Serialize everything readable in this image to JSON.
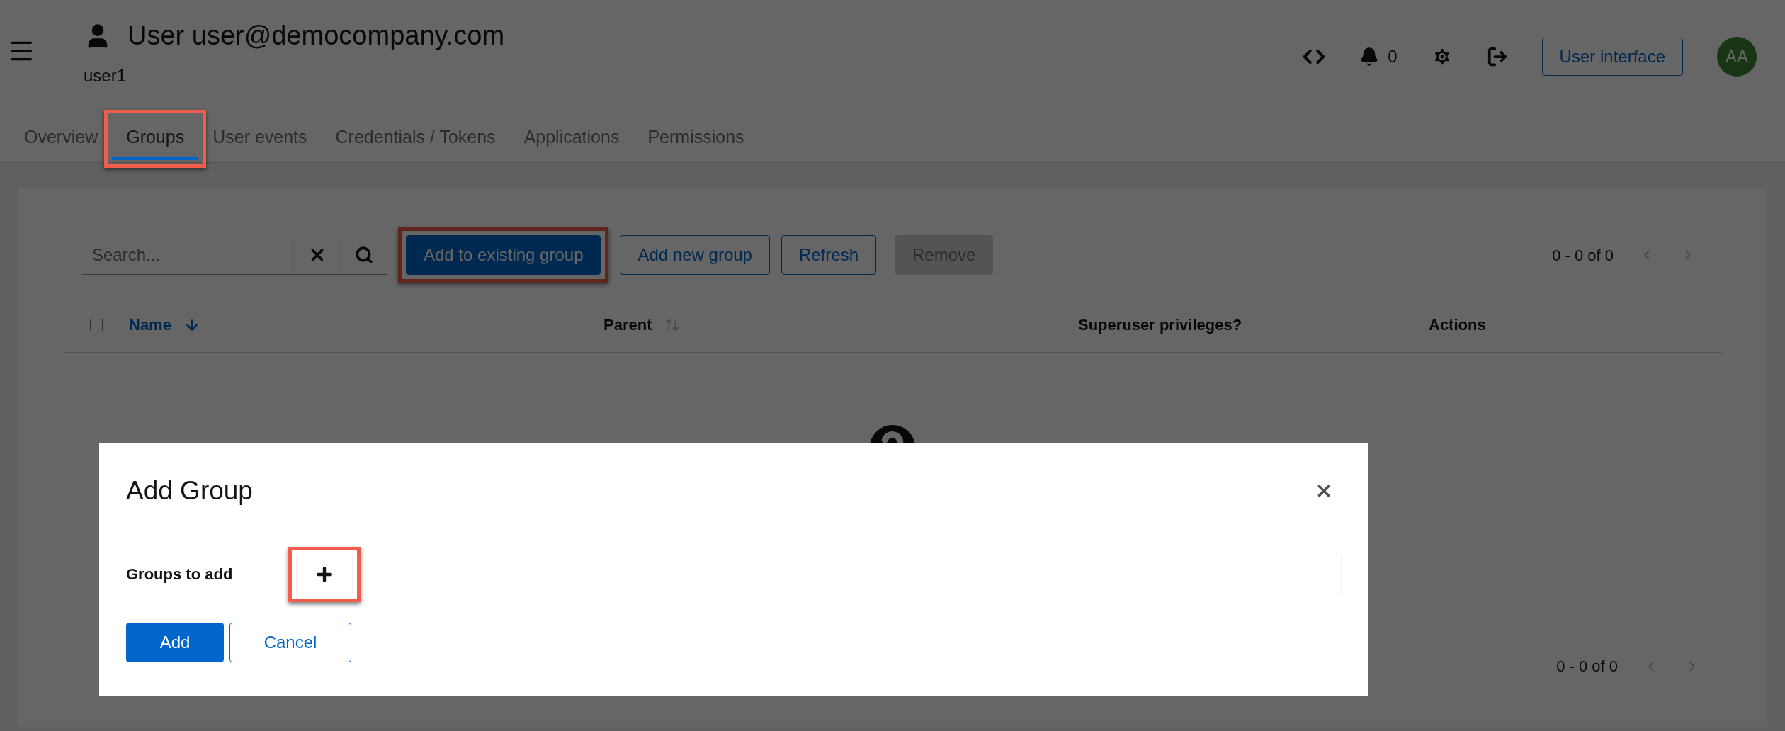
{
  "header": {
    "title": "User user@democompany.com",
    "subtitle": "user1",
    "notifications": "0",
    "ui_button": "User interface",
    "avatar": "AA"
  },
  "tabs": [
    {
      "label": "Overview",
      "selected": false,
      "highlighted": false
    },
    {
      "label": "Groups",
      "selected": true,
      "highlighted": true
    },
    {
      "label": "User events",
      "selected": false,
      "highlighted": false
    },
    {
      "label": "Credentials / Tokens",
      "selected": false,
      "highlighted": false
    },
    {
      "label": "Applications",
      "selected": false,
      "highlighted": false
    },
    {
      "label": "Permissions",
      "selected": false,
      "highlighted": false
    }
  ],
  "toolbar": {
    "search": {
      "placeholder": "Search..."
    },
    "buttons": [
      {
        "label": "Add to existing group",
        "kind": "primary",
        "highlighted": true
      },
      {
        "label": "Add new group",
        "kind": "secondary",
        "highlighted": false
      },
      {
        "label": "Refresh",
        "kind": "secondary",
        "highlighted": false
      },
      {
        "label": "Remove",
        "kind": "disabled",
        "highlighted": false
      }
    ],
    "pagination": "0 - 0 of 0"
  },
  "table": {
    "select_all": {
      "checked": false
    },
    "columns": [
      {
        "label": "Name",
        "sort_active": true
      },
      {
        "label": "Parent",
        "sort_active": false
      },
      {
        "label": "Superuser privileges?"
      },
      {
        "label": "Actions"
      }
    ]
  },
  "footer_pagination": "0 - 0 of 0",
  "dialog": {
    "title": "Add Group",
    "field_label": "Groups to add",
    "add_control": {
      "highlighted": true
    },
    "actions": [
      {
        "label": "Add",
        "kind": "primary"
      },
      {
        "label": "Cancel",
        "kind": "secondary"
      }
    ]
  }
}
